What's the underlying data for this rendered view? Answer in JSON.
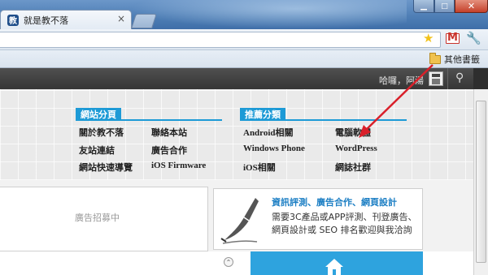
{
  "browser": {
    "tab_title": "就是教不落",
    "tab_favicon_letter": "教",
    "close_glyph": "×",
    "min_glyph": "▁",
    "max_glyph": "□",
    "winclose_glyph": "✕",
    "star_glyph": "★",
    "gmail_letter": "M",
    "wrench_glyph": "🔧",
    "bookmark_folder_label": "其他書籤"
  },
  "site_header": {
    "greeting": "哈囉，阿湯",
    "search_glyph": "⚲"
  },
  "categories": [
    {
      "title": "網站分頁",
      "links": [
        [
          "關於教不落",
          "聯絡本站"
        ],
        [
          "友站連結",
          "廣告合作"
        ],
        [
          "網站快速導覽",
          "iOS Firmware"
        ]
      ]
    },
    {
      "title": "推薦分類",
      "links": [
        [
          "Android相關",
          "電腦軟體"
        ],
        [
          "Windows Phone",
          "WordPress"
        ],
        [
          "iOS相關",
          "網誌社群"
        ]
      ]
    }
  ],
  "ad": {
    "text": "廣告招募中"
  },
  "promo": {
    "title": "資訊評測、廣告合作、網頁設計",
    "description": "需要3C產品或APP評測、刊登廣告、網頁設計或 SEO 排名歡迎與我洽詢"
  },
  "colors": {
    "accent": "#1d9ad6",
    "arrow": "#d9202a",
    "dark_bar": "#3c3c3c"
  }
}
